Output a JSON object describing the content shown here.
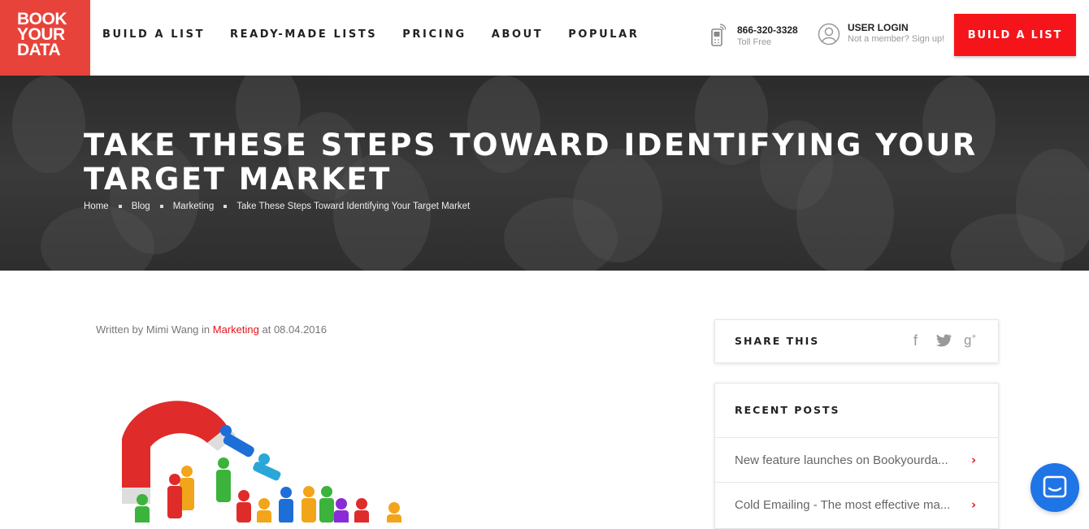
{
  "logo": {
    "line1": "BOOK",
    "line2": "YOUR",
    "line3": "DATA",
    "color": "#e8433b"
  },
  "nav": {
    "items": [
      "BUILD A LIST",
      "READY-MADE LISTS",
      "PRICING",
      "ABOUT",
      "POPULAR"
    ]
  },
  "contact": {
    "phone": "866-320-3328",
    "phone_sub": "Toll Free"
  },
  "login": {
    "title": "USER LOGIN",
    "sub": "Not a member? Sign up!"
  },
  "cta": {
    "label": "BUILD A LIST",
    "color": "#f5141a"
  },
  "hero": {
    "title": "TAKE THESE STEPS TOWARD IDENTIFYING YOUR TARGET MARKET",
    "breadcrumb": [
      "Home",
      "Blog",
      "Marketing",
      "Take These Steps Toward Identifying Your Target Market"
    ]
  },
  "meta": {
    "prefix": "Written by Mimi Wang in",
    "category": "Marketing",
    "suffix": "at 08.04.2016"
  },
  "share": {
    "title": "SHARE THIS",
    "icons": [
      "facebook-icon",
      "twitter-icon",
      "google-plus-icon"
    ]
  },
  "recent": {
    "title": "RECENT POSTS",
    "posts": [
      "New feature launches on Bookyourda...",
      "Cold Emailing - The most effective ma..."
    ]
  },
  "accent": "#e3141a",
  "chat": {
    "icon": "chat-icon",
    "color": "#1f74e6"
  }
}
